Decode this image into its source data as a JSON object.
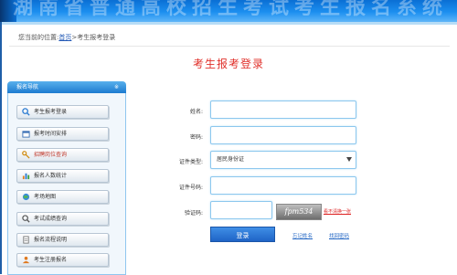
{
  "banner": {
    "title": "湖南省普通高校招生考试考生报名系统"
  },
  "breadcrumb": {
    "prefix": "您当前的位置:",
    "home": "首页",
    "separator": ">",
    "current": "考生报考登录"
  },
  "page_title": "考生报考登录",
  "sidebar": {
    "header": "报名导航",
    "toggle": "※",
    "items": [
      {
        "label": "考生报考登录",
        "icon": "search-icon"
      },
      {
        "label": "报考时间安排",
        "icon": "calendar-icon"
      },
      {
        "label": "招聘岗位查询",
        "icon": "key-icon"
      },
      {
        "label": "报名人数统计",
        "icon": "chart-icon"
      },
      {
        "label": "考场地图",
        "icon": "map-icon"
      },
      {
        "label": "考试成绩查询",
        "icon": "magnifier-icon"
      },
      {
        "label": "报名流程说明",
        "icon": "document-icon"
      },
      {
        "label": "考生注册报名",
        "icon": "user-icon"
      }
    ]
  },
  "form": {
    "name_label": "姓名:",
    "name_value": "",
    "password_label": "密码:",
    "password_value": "",
    "id_type_label": "证件类型:",
    "id_type_value": "居民身份证",
    "id_number_label": "证件号码:",
    "id_number_value": "",
    "captcha_label": "验证码:",
    "captcha_value": "",
    "captcha_image_text": "fpm534",
    "refresh_label": "看不清换一张",
    "login_label": "登录",
    "forgot_name_label": "忘记姓名",
    "forgot_password_label": "找回密码"
  },
  "colors": {
    "accent": "#1f64c6",
    "title": "#e0302a",
    "banner": "#0a6fd4"
  }
}
